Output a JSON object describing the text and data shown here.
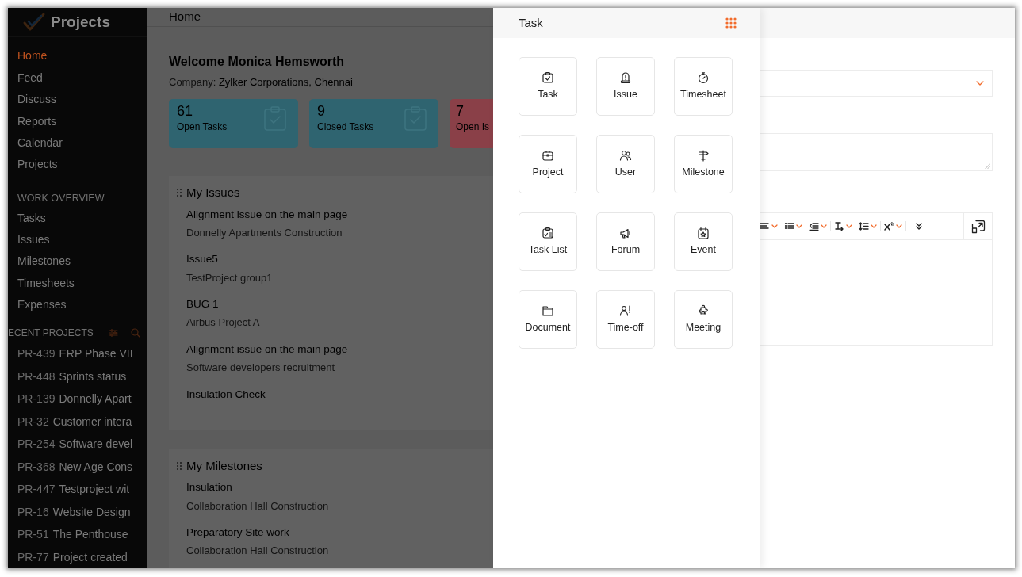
{
  "sidebar": {
    "app_title": "Projects",
    "nav": [
      {
        "label": "Home",
        "selected": true
      },
      {
        "label": "Feed",
        "selected": false
      },
      {
        "label": "Discuss",
        "selected": false
      },
      {
        "label": "Reports",
        "selected": false
      },
      {
        "label": "Calendar",
        "selected": false
      },
      {
        "label": "Projects",
        "selected": false
      }
    ],
    "work_overview": {
      "heading": "WORK OVERVIEW",
      "items": [
        "Tasks",
        "Issues",
        "Milestones",
        "Timesheets",
        "Expenses"
      ]
    },
    "recent_projects": {
      "heading": "ECENT PROJECTS",
      "items": [
        {
          "id": "PR-439",
          "name": "ERP Phase VII"
        },
        {
          "id": "PR-448",
          "name": "Sprints status"
        },
        {
          "id": "PR-139",
          "name": "Donnelly Apart"
        },
        {
          "id": "PR-32",
          "name": "Customer intera"
        },
        {
          "id": "PR-254",
          "name": "Software devel"
        },
        {
          "id": "PR-368",
          "name": "New Age Cons"
        },
        {
          "id": "PR-447",
          "name": "Testproject wit"
        },
        {
          "id": "PR-16",
          "name": "Website Design"
        },
        {
          "id": "PR-51",
          "name": "The Penthouse"
        },
        {
          "id": "PR-77",
          "name": "Project created"
        }
      ]
    }
  },
  "main": {
    "title": "Home",
    "welcome": "Welcome Monica Hemsworth",
    "company_label": "Company:",
    "company": "Zylker Corporations, Chennai",
    "stats": [
      {
        "count": "61",
        "label": "Open Tasks",
        "color": "#2f6470",
        "icon": true
      },
      {
        "count": "9",
        "label": "Closed Tasks",
        "color": "#2f6470",
        "icon": true
      },
      {
        "count": "7",
        "label": "Open Is",
        "color": "#8a4048",
        "icon": false
      }
    ],
    "sections": [
      {
        "title": "My Issues",
        "items": [
          {
            "title": "Alignment issue on the main page",
            "project": "Donnelly Apartments Construction"
          },
          {
            "title": "Issue5",
            "project": "TestProject group1"
          },
          {
            "title": "BUG 1",
            "project": "Airbus Project A"
          },
          {
            "title": "Alignment issue on the main page",
            "project": "Software developers recruitment"
          },
          {
            "title": "Insulation Check"
          }
        ]
      },
      {
        "title": "My Milestones",
        "items": [
          {
            "title": "Insulation",
            "project": "Collaboration Hall Construction"
          },
          {
            "title": "Preparatory Site work",
            "project": "Collaboration Hall Construction"
          }
        ]
      }
    ]
  },
  "create_panel": {
    "title": "Task",
    "tiles": [
      {
        "label": "Task",
        "kind": "task"
      },
      {
        "label": "Issue",
        "kind": "issue"
      },
      {
        "label": "Timesheet",
        "kind": "timesheet"
      },
      {
        "label": "Project",
        "kind": "project"
      },
      {
        "label": "User",
        "kind": "user"
      },
      {
        "label": "Milestone",
        "kind": "milestone"
      },
      {
        "label": "Task List",
        "kind": "tasklist"
      },
      {
        "label": "Forum",
        "kind": "forum"
      },
      {
        "label": "Event",
        "kind": "event"
      },
      {
        "label": "Document",
        "kind": "document"
      },
      {
        "label": "Time-off",
        "kind": "timeoff"
      },
      {
        "label": "Meeting",
        "kind": "meeting"
      }
    ]
  },
  "form": {
    "toolbar": [
      {
        "kind": "align",
        "dropdown": true
      },
      {
        "kind": "list",
        "dropdown": true
      },
      {
        "kind": "indent",
        "dropdown": true
      },
      {
        "kind": "direction",
        "dropdown": true
      },
      {
        "kind": "lineheight",
        "dropdown": true
      },
      {
        "kind": "superscript",
        "dropdown": true
      },
      {
        "kind": "more",
        "dropdown": false
      }
    ]
  }
}
